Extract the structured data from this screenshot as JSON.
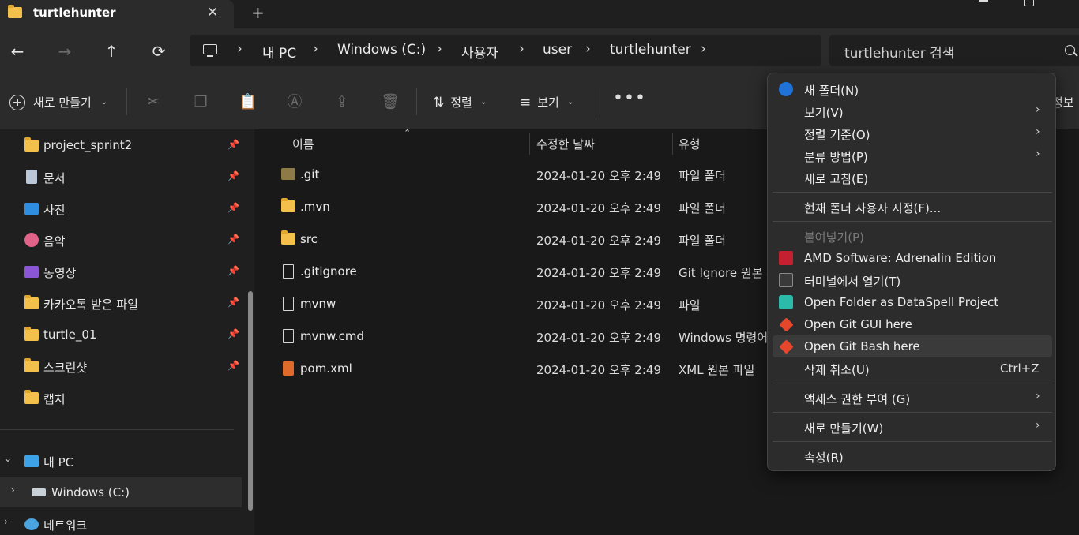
{
  "window": {
    "tab_title": "turtlehunter",
    "tab_close": "✕",
    "new_tab": "+"
  },
  "nav": {
    "back": "←",
    "forward": "→",
    "up": "↑",
    "refresh": "⟳",
    "breadcrumbs": [
      "내 PC",
      "Windows (C:)",
      "사용자",
      "user",
      "turtlehunter"
    ],
    "separator": "›",
    "search_placeholder": "turtlehunter 검색"
  },
  "toolbar": {
    "new_label": "새로 만들기",
    "sort_label": "정렬",
    "view_label": "보기",
    "more": "•••",
    "details_label": "정보",
    "chevron": "⌄",
    "icons": [
      "cut-icon",
      "copy-icon",
      "paste-icon",
      "rename-icon",
      "share-icon",
      "delete-icon"
    ]
  },
  "sidebar": {
    "pin": "📌",
    "items": [
      {
        "label": "project_sprint2",
        "icon": "folder-icon"
      },
      {
        "label": "문서",
        "icon": "document-icon"
      },
      {
        "label": "사진",
        "icon": "pictures-icon"
      },
      {
        "label": "음악",
        "icon": "music-icon"
      },
      {
        "label": "동영상",
        "icon": "video-icon"
      },
      {
        "label": "카카오톡 받은 파일",
        "icon": "folder-icon"
      },
      {
        "label": "turtle_01",
        "icon": "folder-icon"
      },
      {
        "label": "스크린샷",
        "icon": "folder-icon"
      },
      {
        "label": "캡처",
        "icon": "folder-icon"
      }
    ],
    "tree": [
      {
        "label": "내 PC",
        "chevron": "⌄"
      },
      {
        "label": "Windows (C:)",
        "chevron": "›"
      },
      {
        "label": "네트워크",
        "chevron": "›"
      }
    ]
  },
  "filelist": {
    "columns": [
      "이름",
      "수정한 날짜",
      "유형"
    ],
    "sort_caret": "⌃",
    "rows": [
      {
        "name": ".git",
        "date": "2024-01-20 오후 2:49",
        "type": "파일 폴더",
        "icon": "folder-icon"
      },
      {
        "name": ".mvn",
        "date": "2024-01-20 오후 2:49",
        "type": "파일 폴더",
        "icon": "folder-icon"
      },
      {
        "name": "src",
        "date": "2024-01-20 오후 2:49",
        "type": "파일 폴더",
        "icon": "folder-icon"
      },
      {
        "name": ".gitignore",
        "date": "2024-01-20 오후 2:49",
        "type": "Git Ignore 원본 파",
        "icon": "config-file-icon"
      },
      {
        "name": "mvnw",
        "date": "2024-01-20 오후 2:49",
        "type": "파일",
        "icon": "file-icon"
      },
      {
        "name": "mvnw.cmd",
        "date": "2024-01-20 오후 2:49",
        "type": "Windows 명령어",
        "icon": "cmd-file-icon"
      },
      {
        "name": "pom.xml",
        "date": "2024-01-20 오후 2:49",
        "type": "XML 원본 파일",
        "icon": "xml-file-icon"
      }
    ]
  },
  "context_menu": {
    "arrow": "›",
    "items": [
      {
        "label": "새 폴더(N)"
      },
      {
        "label": "보기(V)"
      },
      {
        "label": "정렬 기준(O)"
      },
      {
        "label": "분류 방법(P)"
      },
      {
        "label": "새로 고침(E)"
      },
      {
        "label": "현재 폴더 사용자 지정(F)..."
      },
      {
        "label": "붙여넣기(P)"
      },
      {
        "label": "AMD Software: Adrenalin Edition"
      },
      {
        "label": "터미널에서 열기(T)"
      },
      {
        "label": "Open Folder as DataSpell Project"
      },
      {
        "label": "Open Git GUI here"
      },
      {
        "label": "Open Git Bash here"
      },
      {
        "label": "삭제 취소(U)",
        "shortcut": "Ctrl+Z"
      },
      {
        "label": "액세스 권한 부여 (G)"
      },
      {
        "label": "새로 만들기(W)"
      },
      {
        "label": "속성(R)"
      }
    ]
  }
}
